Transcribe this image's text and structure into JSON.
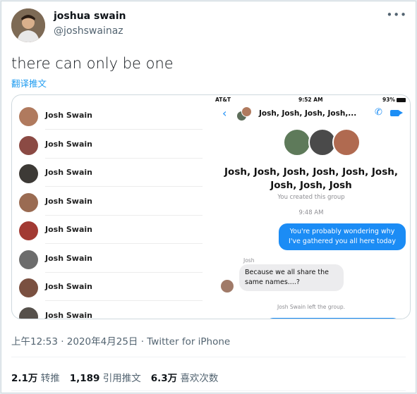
{
  "author": {
    "name": "joshua swain",
    "handle": "@joshswainaz"
  },
  "tweet": {
    "text": "there can only be one",
    "translate_label": "翻译推文",
    "timestamp": "上午12:53 · 2020年4月25日 · Twitter for iPhone"
  },
  "contacts": [
    {
      "name": "Josh Swain",
      "color": "#b07a5e"
    },
    {
      "name": "Josh Swain",
      "color": "#8b4a44"
    },
    {
      "name": "Josh Swain",
      "color": "#3d3a36"
    },
    {
      "name": "Josh Swain",
      "color": "#9a6b52"
    },
    {
      "name": "Josh Swain",
      "color": "#a23a33"
    },
    {
      "name": "Josh Swain",
      "color": "#6c6c6c"
    },
    {
      "name": "Josh Swain",
      "color": "#7a5040"
    },
    {
      "name": "Josh Swain",
      "color": "#55504b"
    }
  ],
  "phone": {
    "carrier": "AT&T",
    "time": "9:52 AM",
    "battery": "93%",
    "header_title": "Josh, Josh, Josh, Josh,...",
    "group_name": "Josh, Josh, Josh, Josh, Josh, Josh, Josh, Josh, Josh",
    "group_sub": "You created this group",
    "chat_time": "9:48 AM",
    "outgoing": "You're probably wondering why I've gathered you all here today",
    "sender": "Josh",
    "incoming": "Because we all share the same names....?",
    "notice": "Josh Swain left the group."
  },
  "stats": [
    {
      "value": "2.1万",
      "label": "转推"
    },
    {
      "value": "1,189",
      "label": "引用推文"
    },
    {
      "value": "6.3万",
      "label": "喜欢次数"
    }
  ]
}
